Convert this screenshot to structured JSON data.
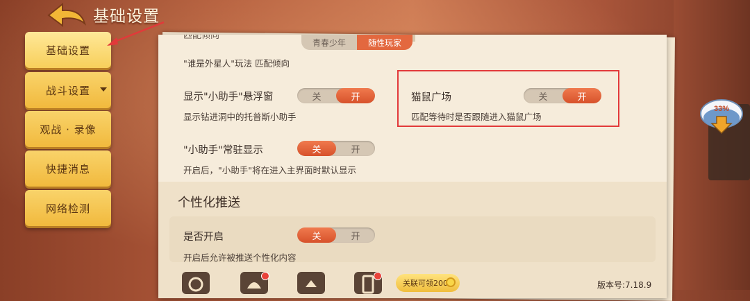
{
  "header": {
    "title": "基础设置"
  },
  "nav": {
    "items": [
      {
        "label": "基础设置",
        "active": true
      },
      {
        "label": "战斗设置",
        "has_dropdown": true
      },
      {
        "label": "观战 · 录像"
      },
      {
        "label": "快捷消息"
      },
      {
        "label": "网络检测"
      }
    ]
  },
  "settings": {
    "clipped_top": {
      "label": "匹配倾向",
      "opt_a": "青春少年",
      "opt_b": "随性玩家"
    },
    "alien_mode": {
      "desc": "\"谁是外星人\"玩法 匹配倾向"
    },
    "assistant_float": {
      "label": "显示\"小助手\"悬浮窗",
      "desc": "显示钻进洞中的托普斯小助手",
      "off": "关",
      "on": "开",
      "value": "on"
    },
    "assistant_resident": {
      "label": "\"小助手\"常驻显示",
      "desc": "开启后，\"小助手\"将在进入主界面时默认显示",
      "off": "关",
      "on": "开",
      "value": "off"
    },
    "cat_mouse_plaza": {
      "label": "猫鼠广场",
      "desc": "匹配等待时是否跟随进入猫鼠广场",
      "off": "关",
      "on": "开",
      "value": "on"
    }
  },
  "personalization": {
    "section_title": "个性化推送",
    "enable": {
      "label": "是否开启",
      "desc": "开启后允许被推送个性化内容",
      "off": "关",
      "on": "开",
      "value": "off"
    }
  },
  "bottom_bar": {
    "claim_label": "关联可领200",
    "version": "版本号:7.18.9",
    "icons": [
      "record-icon",
      "bird-icon",
      "mail-icon",
      "phone-icon"
    ]
  },
  "download_badge": {
    "percent": "33%"
  },
  "colors": {
    "accent_on": "#e3683f",
    "highlight_border": "#e2393a",
    "nav_yellow": "#f1b93d"
  }
}
